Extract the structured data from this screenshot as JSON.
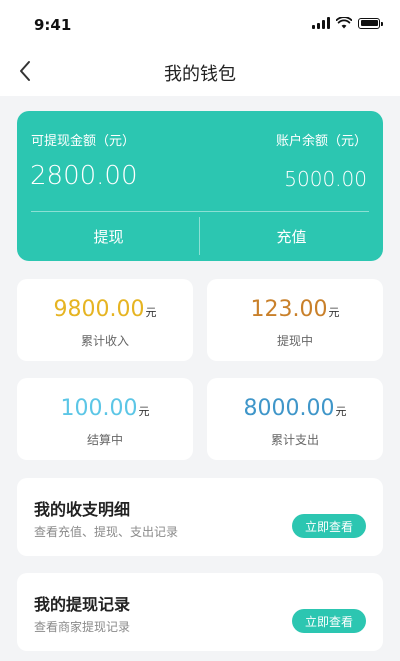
{
  "status_bar": {
    "time": "9:41"
  },
  "nav": {
    "title": "我的钱包"
  },
  "wallet": {
    "withdrawable_label": "可提现金额（元）",
    "withdrawable_amount": "2800.00",
    "balance_label": "账户余额（元）",
    "balance_amount": "5000.00",
    "withdraw_button": "提现",
    "recharge_button": "充值",
    "accent_color": "#2cc6b1"
  },
  "stats": [
    {
      "value": "9800.00",
      "unit": "元",
      "label": "累计收入",
      "color": "#e6b422"
    },
    {
      "value": "123.00",
      "unit": "元",
      "label": "提现中",
      "color": "#c9802a"
    },
    {
      "value": "100.00",
      "unit": "元",
      "label": "结算中",
      "color": "#5cc6e6"
    },
    {
      "value": "8000.00",
      "unit": "元",
      "label": "累计支出",
      "color": "#3f96c9"
    }
  ],
  "records": [
    {
      "title": "我的收支明细",
      "subtitle": "查看充值、提现、支出记录",
      "button": "立即查看"
    },
    {
      "title": "我的提现记录",
      "subtitle": "查看商家提现记录",
      "button": "立即查看"
    }
  ]
}
